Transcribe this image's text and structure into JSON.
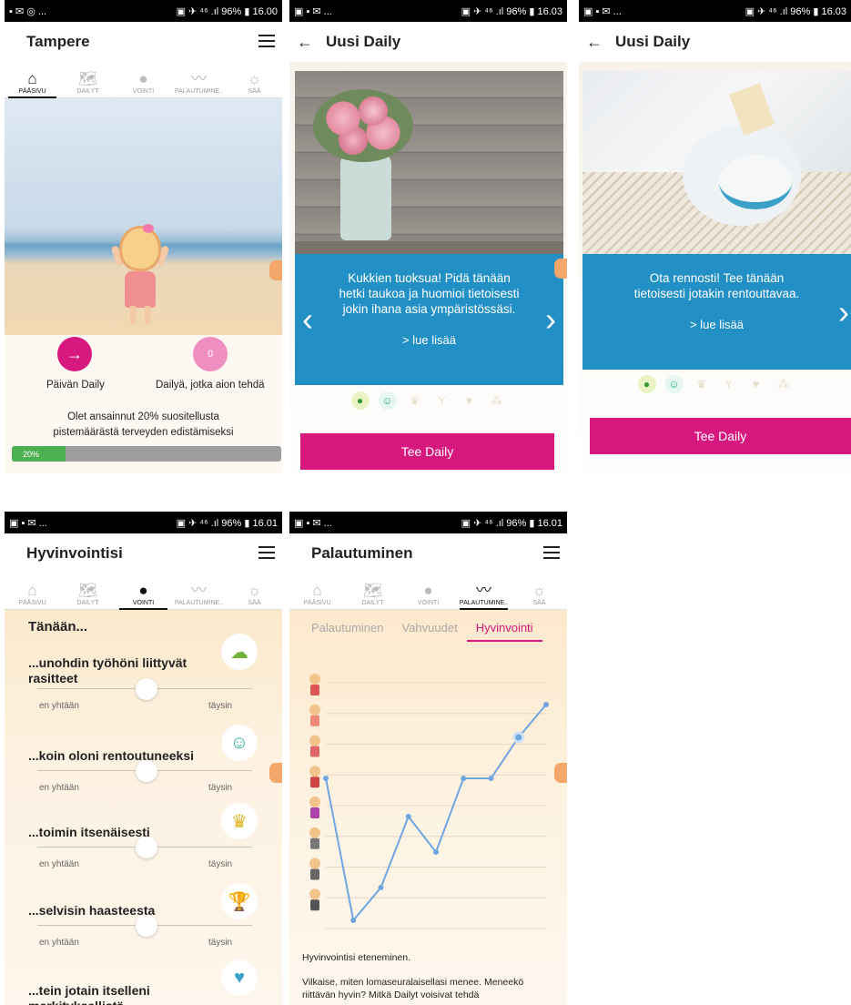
{
  "p1": {
    "status": {
      "left": "▪ ✉ ◎ ...",
      "right": "▣ ✈ ⁴⁶ .ıl 96% ▮ 16.00"
    },
    "title": "Tampere",
    "tabs": [
      {
        "label": "PÄÄSIVU",
        "icon": "⌂"
      },
      {
        "label": "DAILYT",
        "icon": "🗺"
      },
      {
        "label": "VOINTI",
        "icon": "●"
      },
      {
        "label": "PALAUTUMINE..",
        "icon": "〰"
      },
      {
        "label": "SÄÄ",
        "icon": "☼"
      }
    ],
    "daily_btn": "Päivän Daily",
    "daily_arrow": "→",
    "count": "0",
    "count_label": "Dailyä, jotka aion tehdä",
    "points_text": "Olet ansainnut 20% suositellusta pistemäärästä terveyden edistämiseksi",
    "progress_label": "20%",
    "progress": 0.2,
    "colors": {
      "pink": "#d6187f",
      "lightpink": "#ef8fc0",
      "green": "#4caf50"
    }
  },
  "p2": {
    "status": {
      "left": "▣ ▪ ✉ ...",
      "right": "▣ ✈ ⁴⁶ .ıl 96% ▮ 16.03"
    },
    "back": "←",
    "title": "Uusi Daily",
    "quote": "Kukkien tuoksua! Pidä tänään hetki taukoa ja huomioi tietoisesti jokin ihana asia ympäristössäsi.",
    "more": "> lue lisää",
    "prev": "‹",
    "next": "›",
    "button": "Tee Daily"
  },
  "p3": {
    "status": {
      "left": "▣ ▪ ✉ ...",
      "right": "▣ ✈ ⁴⁶ .ıl 96% ▮ 16.03"
    },
    "back": "←",
    "title": "Uusi Daily",
    "quote": "Ota rennosti! Tee tänään tietoisesti jotakin rentouttavaa.",
    "more": "> lue lisää",
    "next": "›",
    "button": "Tee Daily"
  },
  "p4": {
    "status": {
      "left": "▣ ▪ ✉ ...",
      "right": "▣ ✈ ⁴⁶ .ıl 96% ▮ 16.01"
    },
    "title": "Hyvinvointisi",
    "heading": "Tänään...",
    "items": [
      {
        "q": "...unohdin työhöni liittyvät rasitteet",
        "icon": "☁"
      },
      {
        "q": "...koin oloni rentoutuneeksi",
        "icon": "☺"
      },
      {
        "q": "...toimin itsenäisesti",
        "icon": "♛"
      },
      {
        "q": "...selvisin haasteesta",
        "icon": "🏆"
      },
      {
        "q": "...tein jotain itselleni merkityksellistä",
        "icon": "♥"
      }
    ],
    "min": "en yhtään",
    "max": "täysin"
  },
  "p5": {
    "status": {
      "left": "▣ ▪ ✉ ...",
      "right": "▣ ✈ ⁴⁶ .ıl 96% ▮ 16.01"
    },
    "title": "Palautuminen",
    "subtabs": [
      "Palautuminen",
      "Vahvuudet",
      "Hyvinvointi"
    ],
    "chart_data": {
      "type": "line",
      "values": [
        5.5,
        0.3,
        1.5,
        4.1,
        2.8,
        5.5,
        5.5,
        7.0,
        8.2
      ],
      "ylim": [
        0,
        9
      ],
      "highlight_index": 7,
      "color": "#6ea6e0",
      "grid": true
    },
    "caption": "Hyvinvointisi eteneminen.",
    "desc": "Vilkaise, miten lomaseuralaisellasi menee. Meneekö riittävän hyvin? Mitkä Dailyt voisivat tehdä"
  }
}
